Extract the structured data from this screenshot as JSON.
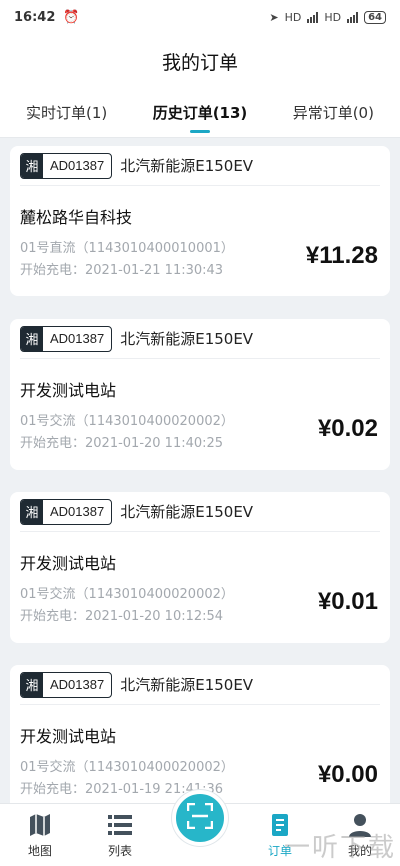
{
  "status_bar": {
    "time": "16:42",
    "battery": "64"
  },
  "header": {
    "title": "我的订单"
  },
  "tabs": [
    {
      "label": "实时订单(1)"
    },
    {
      "label": "历史订单(13)"
    },
    {
      "label": "异常订单(0)"
    }
  ],
  "orders": [
    {
      "province": "湘",
      "plate": "AD01387",
      "vehicle": "北汽新能源E150EV",
      "station": "麓松路华自科技",
      "pile": "01号直流（1143010400010001）",
      "start": "开始充电：2021-01-21 11:30:43",
      "amount": "¥11.28"
    },
    {
      "province": "湘",
      "plate": "AD01387",
      "vehicle": "北汽新能源E150EV",
      "station": "开发测试电站",
      "pile": "01号交流（1143010400020002）",
      "start": "开始充电：2021-01-20 11:40:25",
      "amount": "¥0.02"
    },
    {
      "province": "湘",
      "plate": "AD01387",
      "vehicle": "北汽新能源E150EV",
      "station": "开发测试电站",
      "pile": "01号交流（1143010400020002）",
      "start": "开始充电：2021-01-20 10:12:54",
      "amount": "¥0.01"
    },
    {
      "province": "湘",
      "plate": "AD01387",
      "vehicle": "北汽新能源E150EV",
      "station": "开发测试电站",
      "pile": "01号交流（1143010400020002）",
      "start": "开始充电：2021-01-19 21:41:36",
      "amount": "¥0.00"
    }
  ],
  "nav": {
    "map": {
      "label": "地图",
      "icon": "map-icon"
    },
    "list": {
      "label": "列表",
      "icon": "list-icon"
    },
    "scan": {
      "icon": "scan-icon"
    },
    "orders": {
      "label": "订单",
      "icon": "order-icon"
    },
    "mine": {
      "label": "我的",
      "icon": "user-icon"
    }
  },
  "watermark": "一听下载",
  "colors": {
    "accent": "#1ba7c5",
    "scan": "#27b6c9",
    "plate_dark": "#1f2a33"
  }
}
